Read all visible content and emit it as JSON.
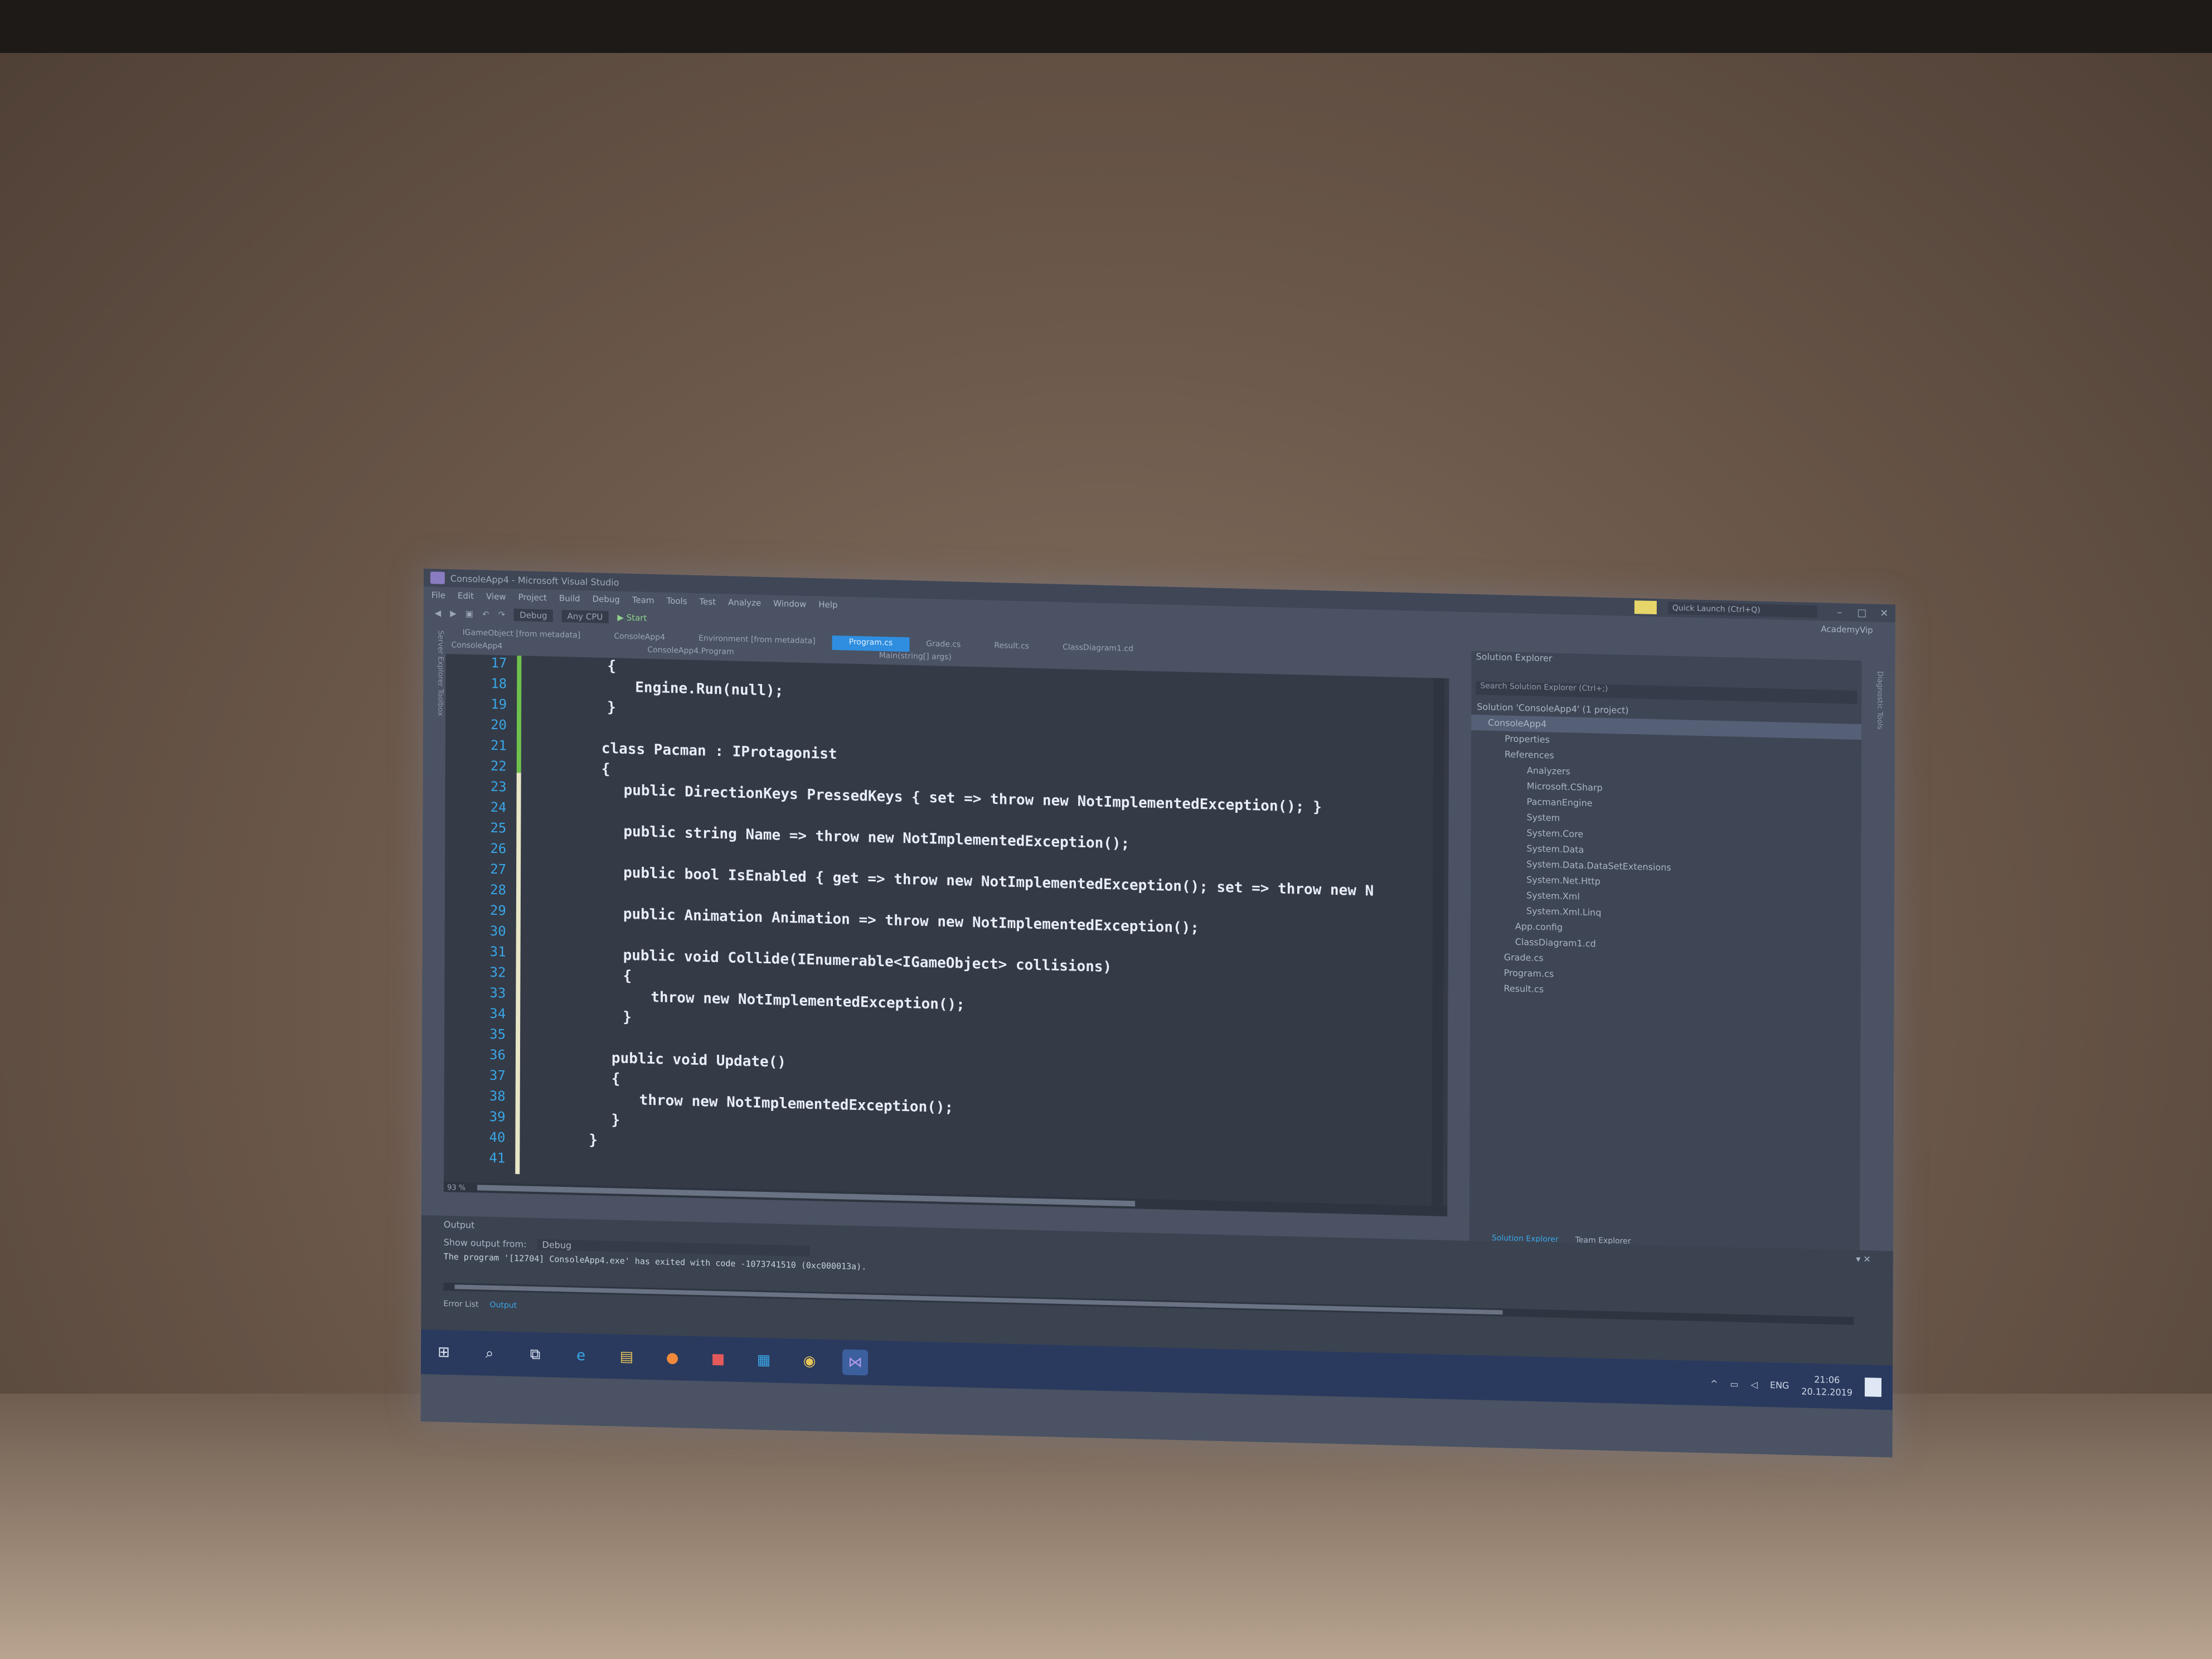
{
  "window": {
    "title": "ConsoleApp4 - Microsoft Visual Studio",
    "quick_launch": "Quick Launch (Ctrl+Q)",
    "account": "AcademyVip"
  },
  "menu": [
    "File",
    "Edit",
    "View",
    "Project",
    "Build",
    "Debug",
    "Team",
    "Tools",
    "Test",
    "Analyze",
    "Window",
    "Help"
  ],
  "toolbar": {
    "config": "Debug",
    "platform": "Any CPU",
    "start": "▶ Start"
  },
  "tabs": [
    {
      "label": "IGameObject [from metadata]",
      "active": false
    },
    {
      "label": "ConsoleApp4",
      "active": false
    },
    {
      "label": "Environment [from metadata]",
      "active": false
    },
    {
      "label": "Program.cs",
      "active": true
    },
    {
      "label": "Grade.cs",
      "active": false
    },
    {
      "label": "Result.cs",
      "active": false
    },
    {
      "label": "ClassDiagram1.cd",
      "active": false
    }
  ],
  "navbar": {
    "project": "ConsoleApp4",
    "type": "ConsoleApp4.Program",
    "member": "Main(string[] args)"
  },
  "left_strip": "Server Explorer   Toolbox",
  "editor": {
    "zoom": "93 %",
    "line_numbers": [
      "17",
      "18",
      "19",
      "20",
      "21",
      "22",
      "23",
      "24",
      "25",
      "26",
      "27",
      "28",
      "29",
      "30",
      "31",
      "32",
      "33",
      "34",
      "35",
      "36",
      "37",
      "38",
      "39",
      "40",
      "41"
    ],
    "lines": [
      {
        "n": "17",
        "text": "{"
      },
      {
        "n": "18",
        "text": "Engine.Run(null);"
      },
      {
        "n": "19",
        "text": "}"
      },
      {
        "n": "21",
        "text": "class Pacman : IProtagonist"
      },
      {
        "n": "22",
        "text": "{"
      },
      {
        "n": "23",
        "text": "public DirectionKeys PressedKeys { set => throw new NotImplementedException(); }"
      },
      {
        "n": "25",
        "text": "public string Name => throw new NotImplementedException();"
      },
      {
        "n": "27",
        "text": "public bool IsEnabled { get => throw new NotImplementedException(); set => throw new N"
      },
      {
        "n": "29",
        "text": "public Animation Animation => throw new NotImplementedException();"
      },
      {
        "n": "31",
        "text": "public void Collide(IEnumerable<IGameObject> collisions)"
      },
      {
        "n": "32",
        "text": "{"
      },
      {
        "n": "33",
        "text": "throw new NotImplementedException();"
      },
      {
        "n": "34",
        "text": "}"
      },
      {
        "n": "36",
        "text": "public void Update()"
      },
      {
        "n": "37",
        "text": "{"
      },
      {
        "n": "38",
        "text": "throw new NotImplementedException();"
      },
      {
        "n": "39",
        "text": "}"
      },
      {
        "n": "40",
        "text": "}"
      }
    ]
  },
  "solution_explorer": {
    "title": "Solution Explorer",
    "search_placeholder": "Search Solution Explorer (Ctrl+;)",
    "tree": [
      {
        "label": "Solution 'ConsoleApp4' (1 project)",
        "level": 0
      },
      {
        "label": "ConsoleApp4",
        "level": 1,
        "selected": true
      },
      {
        "label": "Properties",
        "level": 2
      },
      {
        "label": "References",
        "level": 2
      },
      {
        "label": "Analyzers",
        "level": 3
      },
      {
        "label": "Microsoft.CSharp",
        "level": 3
      },
      {
        "label": "PacmanEngine",
        "level": 3
      },
      {
        "label": "System",
        "level": 3
      },
      {
        "label": "System.Core",
        "level": 3
      },
      {
        "label": "System.Data",
        "level": 3
      },
      {
        "label": "System.Data.DataSetExtensions",
        "level": 3
      },
      {
        "label": "System.Net.Http",
        "level": 3
      },
      {
        "label": "System.Xml",
        "level": 3
      },
      {
        "label": "System.Xml.Linq",
        "level": 3
      },
      {
        "label": "App.config",
        "level": 2
      },
      {
        "label": "ClassDiagram1.cd",
        "level": 2
      },
      {
        "label": "Grade.cs",
        "level": 2
      },
      {
        "label": "Program.cs",
        "level": 2
      },
      {
        "label": "Result.cs",
        "level": 2
      }
    ],
    "bottom_tabs": [
      "Solution Explorer",
      "Team Explorer"
    ],
    "right_strip": "Diagnostic Tools"
  },
  "output": {
    "title": "Output",
    "show_from_label": "Show output from:",
    "show_from_value": "Debug",
    "line": "The program '[12704] ConsoleApp4.exe' has exited with code -1073741510 (0xc000013a).",
    "bottom_tabs": [
      "Error List",
      "Output"
    ]
  },
  "taskbar": {
    "icons": [
      "windows-icon",
      "search-icon",
      "task-view-icon",
      "edge-icon",
      "file-explorer-icon",
      "firefox-icon",
      "mail-icon",
      "store-icon",
      "chrome-icon",
      "visual-studio-icon"
    ],
    "lang": "ENG",
    "time": "21:06",
    "date": "20.12.2019"
  }
}
